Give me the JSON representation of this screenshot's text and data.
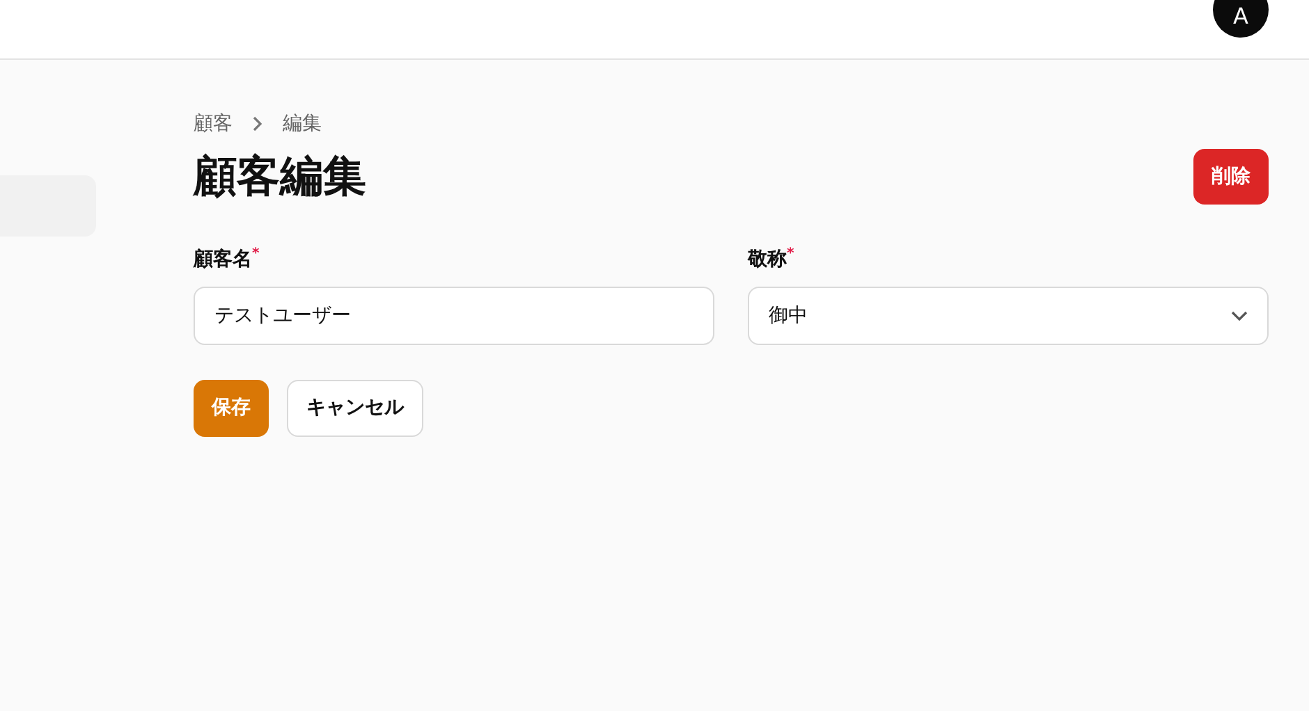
{
  "header": {
    "avatar": "A"
  },
  "breadcrumb": [
    "顧客",
    "編集"
  ],
  "page_title": "顧客編集",
  "delete_button": "削除",
  "fields": [
    {
      "kind": "text",
      "label": "顧客名$^{*}$",
      "value": "テストユーザー"
    },
    {
      "kind": "select",
      "label": "敬称$^{*}$",
      "value": "御中"
    }
  ],
  "buttons": [
    {
      "label": "保存",
      "primary": true
    },
    {
      "label": "キャンセル",
      "primary": false
    }
  ]
}
